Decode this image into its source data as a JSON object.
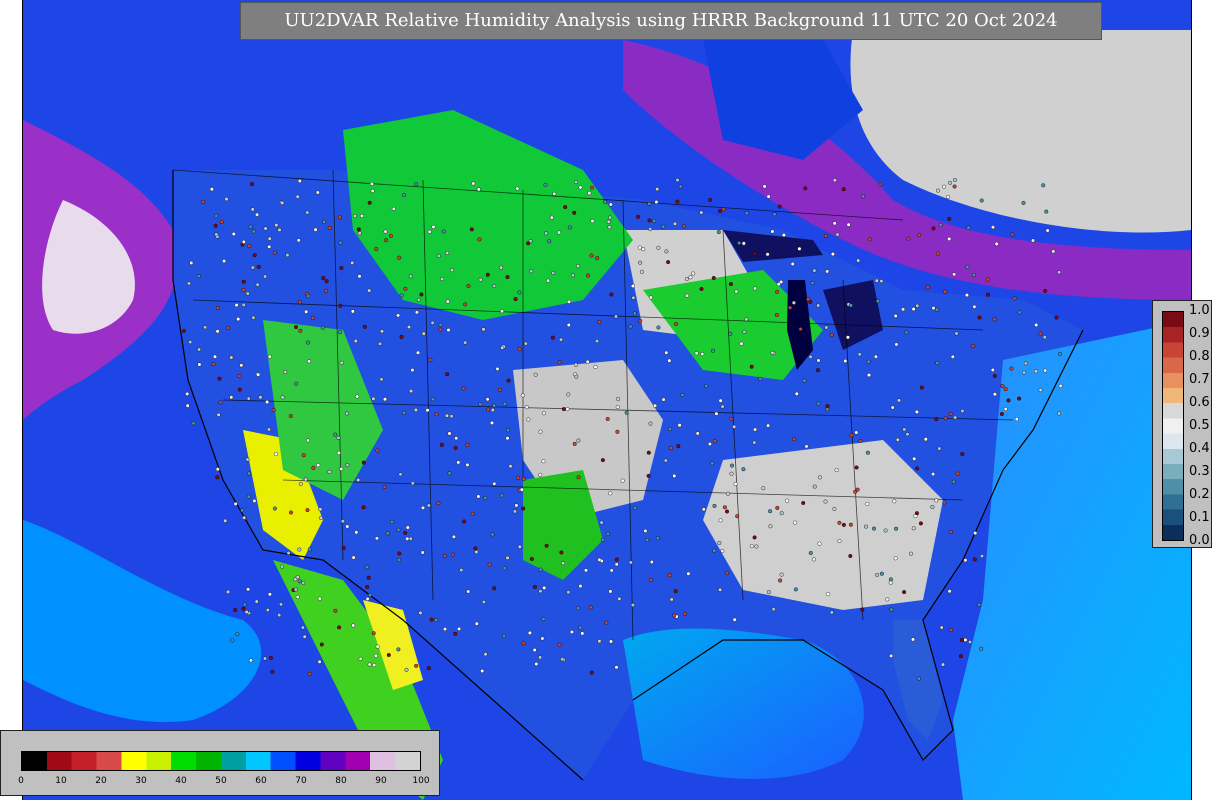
{
  "title": "UU2DVAR Relative Humidity Analysis using HRRR Background 11 UTC 20 Oct 2024",
  "station_colorbar": {
    "ticks": [
      "1.0",
      "0.9",
      "0.8",
      "0.7",
      "0.6",
      "0.5",
      "0.4",
      "0.3",
      "0.2",
      "0.1",
      "0.0"
    ],
    "colors": [
      "#0b2f5a",
      "#1b4f7d",
      "#2f6f94",
      "#4f8fa8",
      "#7aaebf",
      "#a8c8d6",
      "#dde6ee",
      "#f0f0f0",
      "#d8d8d8",
      "#f0b878",
      "#e89060",
      "#d86848",
      "#c84434",
      "#a82424",
      "#7a0a14"
    ]
  },
  "analysis_colorbar": {
    "ticks": [
      "0",
      "10",
      "20",
      "30",
      "40",
      "50",
      "60",
      "70",
      "80",
      "90",
      "100"
    ],
    "colors": [
      "#000000",
      "#a00a14",
      "#c41e2a",
      "#d84a4a",
      "#ffff00",
      "#c8f000",
      "#00dd00",
      "#00b400",
      "#00a0a0",
      "#00c8ff",
      "#0050ff",
      "#0000e0",
      "#6000c0",
      "#a000b0",
      "#e0c0e0",
      "#d3d3d3"
    ]
  }
}
